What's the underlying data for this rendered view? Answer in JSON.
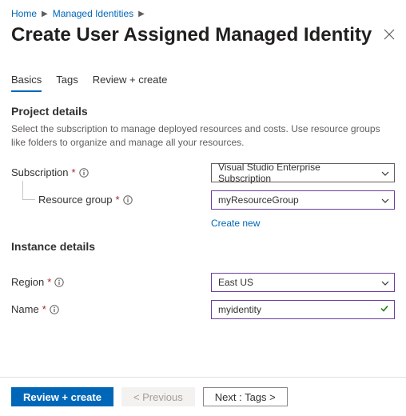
{
  "breadcrumb": {
    "items": [
      {
        "label": "Home"
      },
      {
        "label": "Managed Identities"
      }
    ]
  },
  "title": "Create User Assigned Managed Identity",
  "tabs": [
    {
      "label": "Basics",
      "active": true
    },
    {
      "label": "Tags",
      "active": false
    },
    {
      "label": "Review + create",
      "active": false
    }
  ],
  "project_details": {
    "heading": "Project details",
    "description": "Select the subscription to manage deployed resources and costs. Use resource groups like folders to organize and manage all your resources.",
    "subscription_label": "Subscription",
    "subscription_value": "Visual Studio Enterprise Subscription",
    "resource_group_label": "Resource group",
    "resource_group_value": "myResourceGroup",
    "create_new_label": "Create new"
  },
  "instance_details": {
    "heading": "Instance details",
    "region_label": "Region",
    "region_value": "East US",
    "name_label": "Name",
    "name_value": "myidentity"
  },
  "footer": {
    "review_create": "Review + create",
    "previous": "< Previous",
    "next": "Next : Tags >"
  },
  "required_marker": "*"
}
